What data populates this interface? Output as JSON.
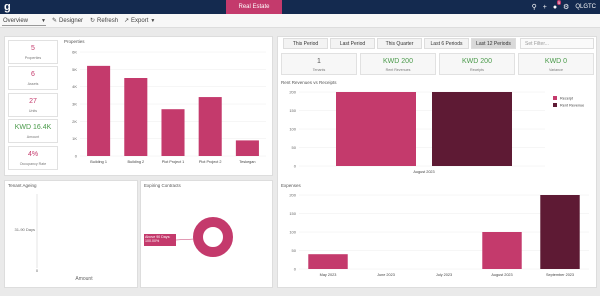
{
  "topbar": {
    "title": "Real Estate",
    "notification_count": "5",
    "user": "QLGTC",
    "logo": "g"
  },
  "toolbar": {
    "view": "Overview",
    "designer": "Designer",
    "refresh": "Refresh",
    "export": "Export"
  },
  "kpis": [
    {
      "value": "5",
      "label": "Properties"
    },
    {
      "value": "6",
      "label": "Assets"
    },
    {
      "value": "27",
      "label": "Units"
    },
    {
      "value": "KWD 16.4K",
      "label": "Amount"
    },
    {
      "value": "4%",
      "label": "Occupancy Rate"
    }
  ],
  "periods": [
    "This Period",
    "Last Period",
    "This Quarter",
    "Last 6 Periods",
    "Last 12 Periods"
  ],
  "filter_placeholder": "Set Filter...",
  "summary": [
    {
      "value": "1",
      "label": "Tenants"
    },
    {
      "value": "KWD 200",
      "label": "Rent Revenues"
    },
    {
      "value": "KWD 200",
      "label": "Receipts"
    },
    {
      "value": "KWD 0",
      "label": "Variance"
    }
  ],
  "colors": {
    "accent": "#c43a6c",
    "dark": "#5e1a34",
    "navy": "#142a4f",
    "green": "#4a9a4a"
  },
  "tenant_ageing": {
    "title": "Tenant Ageing",
    "category": "31-90 Days",
    "x_tick": "0",
    "x_label": "Amount"
  },
  "expiring": {
    "title": "Expiring Contracts",
    "slice_label": "Above 90 Days: 100.00%"
  },
  "chart_data": [
    {
      "type": "bar",
      "title": "Properties",
      "categories": [
        "Building 1",
        "Building 2",
        "Plot Project 1",
        "Plot Project 2",
        "Teskegan"
      ],
      "values": [
        5.2,
        4.5,
        2.7,
        3.4,
        0.9
      ],
      "ylim": [
        0,
        6
      ],
      "yticks": [
        "0",
        "1K",
        "2K",
        "3K",
        "4K",
        "5K",
        "6K"
      ]
    },
    {
      "type": "bar",
      "title": "Rent Revenues vs Receipts",
      "categories": [
        "August 2023"
      ],
      "series": [
        {
          "name": "Receipt",
          "values": [
            200
          ]
        },
        {
          "name": "Rent Revenue",
          "values": [
            200
          ]
        }
      ],
      "ylim": [
        0,
        200
      ],
      "yticks": [
        "0",
        "50",
        "100",
        "150",
        "200"
      ]
    },
    {
      "type": "bar",
      "title": "Expenses",
      "categories": [
        "May 2023",
        "June 2023",
        "July 2023",
        "August 2023",
        "September 2023"
      ],
      "values": [
        40,
        0,
        0,
        100,
        200
      ],
      "ylim": [
        0,
        200
      ],
      "yticks": [
        "0",
        "50",
        "100",
        "150",
        "200"
      ]
    }
  ]
}
